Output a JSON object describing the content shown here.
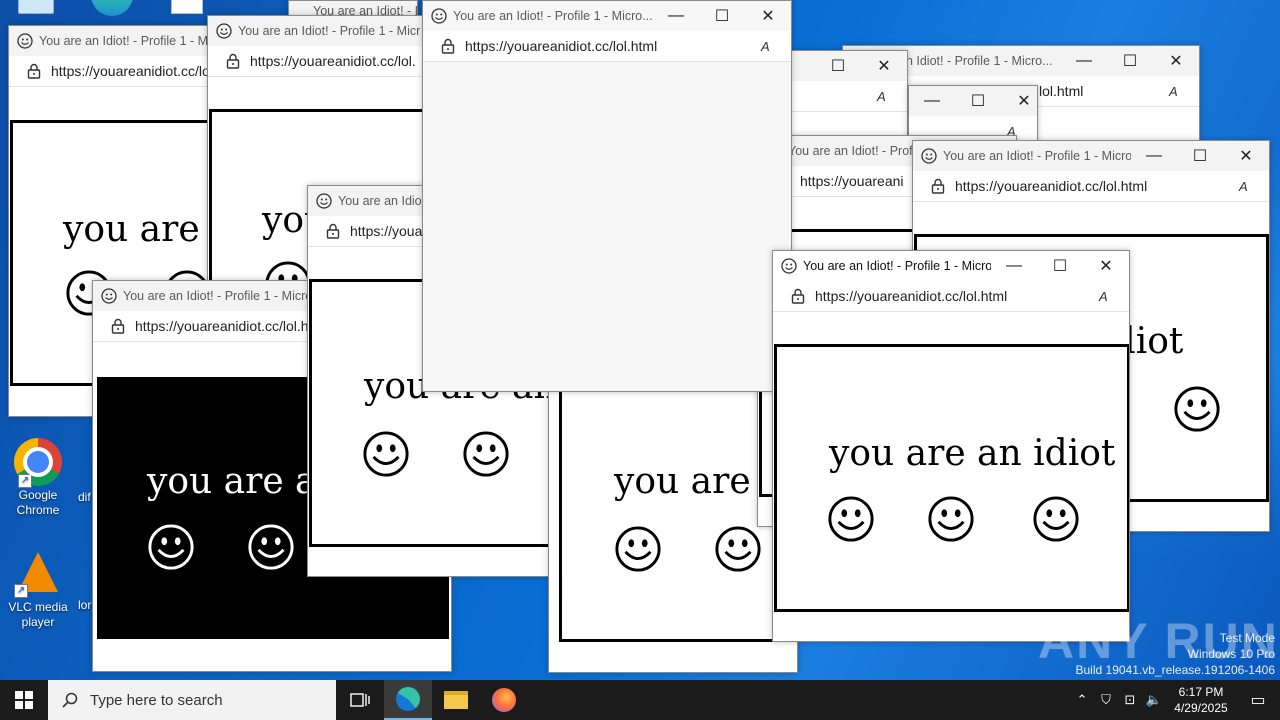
{
  "desktop": {
    "icons": [
      {
        "name": "Google Chrome",
        "label": "Google Chrome"
      },
      {
        "name": "VLC media player",
        "label": "VLC media player"
      }
    ],
    "partial_labels": [
      "dif",
      "lor"
    ]
  },
  "browser": {
    "title": "You are an Idiot! - Profile 1 - Micro...",
    "title_short": "You are an Idiot! - Profile 1 - Micr",
    "title_mid": "You are an Idiot! - Profile",
    "title_tiny": "You are an Idiot! - Pr",
    "title_xs": "You are an Idiot! -",
    "title_tail": "an Idiot! - Profile 1 - Micro...",
    "url": "https://youareanidiot.cc/lol.html",
    "url_short": "https://youareanidiot.cc/lol.",
    "url_tiny": "https://youareani",
    "url_cut": "https://yo",
    "url_cut2": "https://you",
    "url_tail": "lol.html",
    "minimize": "—",
    "maximize": "☐",
    "close": "✕",
    "read_aloud": "A",
    "page_text": "you are an idiot",
    "page_text_partial": "you are an",
    "page_text_short": "you are"
  },
  "taskbar": {
    "search_placeholder": "Type here to search",
    "time": "6:17 PM",
    "date": "4/29/2025"
  },
  "watermark": {
    "line1": "Test Mode",
    "line2": "Windows 10 Pro",
    "line3": "Build 19041.vb_release.191206-1406",
    "brand": "ANY RUN"
  },
  "colors": {
    "desktop_blue": "#0b6fd6",
    "taskbar": "#1b1b1b",
    "edge_blue": "#0078d4"
  }
}
